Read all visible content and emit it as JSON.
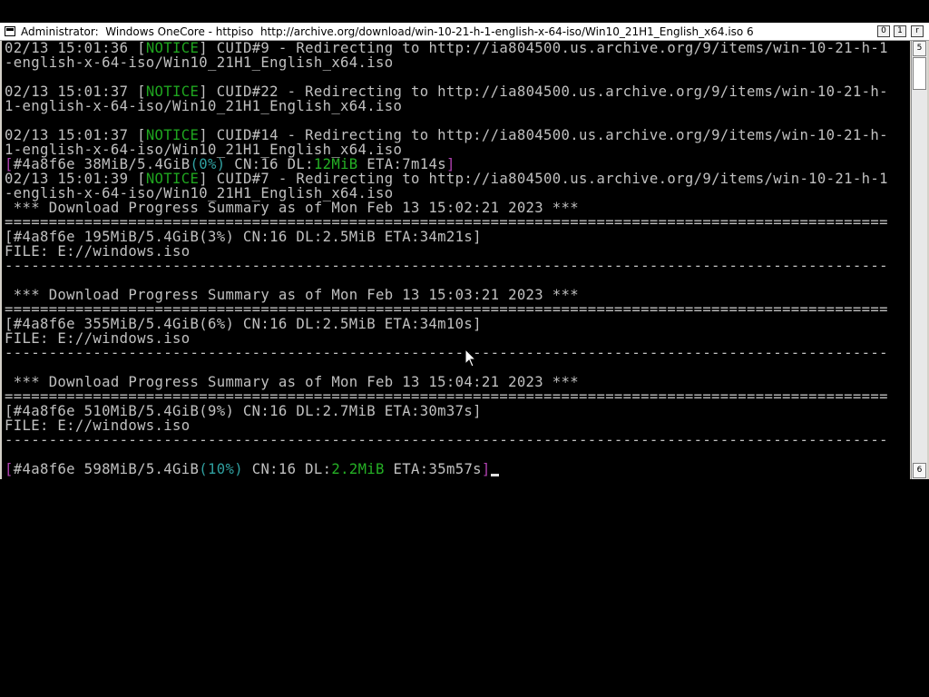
{
  "window": {
    "title": "Administrator:  Windows OneCore - httpiso  http://archive.org/download/win-10-21-h-1-english-x-64-iso/Win10_21H1_English_x64.iso 6",
    "buttons": {
      "minimize": "0",
      "maximize": "1",
      "close": "r"
    }
  },
  "scrollbar": {
    "up_glyph": "5",
    "down_glyph": "6"
  },
  "terminal": {
    "lines": [
      [
        {
          "t": "02/13 15:01:36 ["
        },
        {
          "t": "NOTICE",
          "c": "notice"
        },
        {
          "t": "] CUID#9 - Redirecting to http://ia804500.us.archive.org/9/items/win-10-21-h-1"
        }
      ],
      [
        {
          "t": "-english-x-64-iso/Win10_21H1_English_x64.iso"
        }
      ],
      [
        {
          "t": ""
        }
      ],
      [
        {
          "t": "02/13 15:01:37 ["
        },
        {
          "t": "NOTICE",
          "c": "notice"
        },
        {
          "t": "] CUID#22 - Redirecting to http://ia804500.us.archive.org/9/items/win-10-21-h-"
        }
      ],
      [
        {
          "t": "1-english-x-64-iso/Win10_21H1_English_x64.iso"
        }
      ],
      [
        {
          "t": ""
        }
      ],
      [
        {
          "t": "02/13 15:01:37 ["
        },
        {
          "t": "NOTICE",
          "c": "notice"
        },
        {
          "t": "] CUID#14 - Redirecting to http://ia804500.us.archive.org/9/items/win-10-21-h-"
        }
      ],
      [
        {
          "t": "1-english-x-64-iso/Win10_21H1_English_x64.iso"
        }
      ],
      [
        {
          "t": "[",
          "c": "mag"
        },
        {
          "t": "#4a8f6e 38MiB/5.4GiB"
        },
        {
          "t": "(0%)",
          "c": "cyan"
        },
        {
          "t": " CN:16 DL:"
        },
        {
          "t": "12MiB",
          "c": "green"
        },
        {
          "t": " ETA:7m14s"
        },
        {
          "t": "]",
          "c": "mag"
        }
      ],
      [
        {
          "t": "02/13 15:01:39 ["
        },
        {
          "t": "NOTICE",
          "c": "notice"
        },
        {
          "t": "] CUID#7 - Redirecting to http://ia804500.us.archive.org/9/items/win-10-21-h-1"
        }
      ],
      [
        {
          "t": "-english-x-64-iso/Win10_21H1_English_x64.iso"
        }
      ],
      [
        {
          "t": " *** Download Progress Summary as of Mon Feb 13 15:02:21 2023 ***"
        }
      ],
      [
        {
          "t": "===================================================================================================="
        }
      ],
      [
        {
          "t": "[#4a8f6e 195MiB/5.4GiB(3%) CN:16 DL:2.5MiB ETA:34m21s]"
        }
      ],
      [
        {
          "t": "FILE: E://windows.iso"
        }
      ],
      [
        {
          "t": "----------------------------------------------------------------------------------------------------"
        }
      ],
      [
        {
          "t": ""
        }
      ],
      [
        {
          "t": " *** Download Progress Summary as of Mon Feb 13 15:03:21 2023 ***"
        }
      ],
      [
        {
          "t": "===================================================================================================="
        }
      ],
      [
        {
          "t": "[#4a8f6e 355MiB/5.4GiB(6%) CN:16 DL:2.5MiB ETA:34m10s]"
        }
      ],
      [
        {
          "t": "FILE: E://windows.iso"
        }
      ],
      [
        {
          "t": "----------------------------------------------------------------------------------------------------"
        }
      ],
      [
        {
          "t": ""
        }
      ],
      [
        {
          "t": " *** Download Progress Summary as of Mon Feb 13 15:04:21 2023 ***"
        }
      ],
      [
        {
          "t": "===================================================================================================="
        }
      ],
      [
        {
          "t": "[#4a8f6e 510MiB/5.4GiB(9%) CN:16 DL:2.7MiB ETA:30m37s]"
        }
      ],
      [
        {
          "t": "FILE: E://windows.iso"
        }
      ],
      [
        {
          "t": "----------------------------------------------------------------------------------------------------"
        }
      ],
      [
        {
          "t": ""
        }
      ],
      [
        {
          "t": "[",
          "c": "mag"
        },
        {
          "t": "#4a8f6e 598MiB/5.4GiB"
        },
        {
          "t": "(10%)",
          "c": "cyan"
        },
        {
          "t": " CN:16 DL:"
        },
        {
          "t": "2.2MiB",
          "c": "green"
        },
        {
          "t": " ETA:35m57s"
        },
        {
          "t": "]",
          "c": "mag"
        },
        {
          "cursor": true
        }
      ]
    ]
  },
  "colors": {
    "text": "#c0c0c0",
    "notice": "#1fa51f",
    "magenta": "#b040b0",
    "cyan": "#30a0a0",
    "green": "#25b025",
    "background": "#000000"
  },
  "icons": {
    "window_icon": "console-window-icon",
    "mouse": "arrow-pointer-icon"
  }
}
